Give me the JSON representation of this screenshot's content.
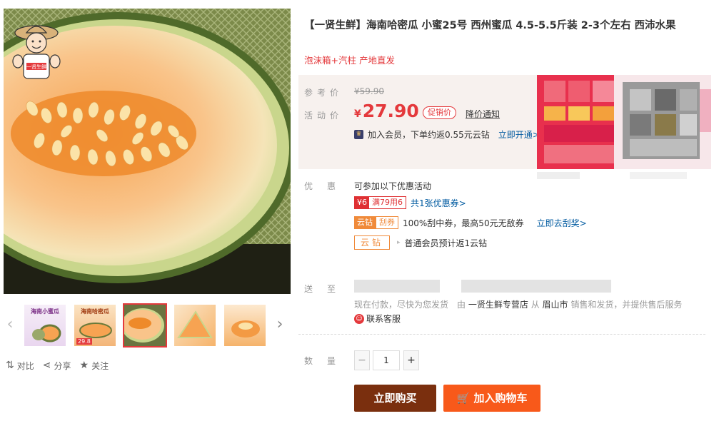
{
  "product": {
    "title": "【一贤生鲜】海南哈密瓜 小蜜25号 西州蜜瓜 4.5-5.5斤装 2-3个左右 西沛水果",
    "subtitle": "泡沫箱+汽柱 产地直发"
  },
  "price": {
    "ref_label": "参考价",
    "ref_value": "¥59.90",
    "act_label": "活动价",
    "currency": "¥",
    "act_value": "27.90",
    "promo_badge": "促销价",
    "notify_label": "降价通知",
    "member_text": "加入会员，下单约返0.55元云钻",
    "member_link": "立即开通>"
  },
  "promotions": {
    "label": "优惠",
    "intro": "可参加以下优惠活动",
    "coupon_a": "¥6",
    "coupon_b": "满79用6",
    "coupon_link": "共1张优惠券>",
    "cloud_a": "云钻",
    "cloud_b": "刮券",
    "cloud_text": "100%刮中券，最高50元无敌券",
    "cloud_link": "立即去刮奖>",
    "cloud_tag": "云钻",
    "cloud_return": "普通会员预计返1云钻"
  },
  "shipping": {
    "label": "送至",
    "note_prefix": "现在付款，尽快为您发货　由",
    "store": "一贤生鲜专营店",
    "note_mid": "从",
    "origin": "眉山市",
    "note_suffix": "销售和发货，并提供售后服务",
    "cs_label": "联系客服"
  },
  "quantity": {
    "label": "数量",
    "minus": "−",
    "value": "1",
    "plus": "+"
  },
  "buttons": {
    "buy": "立即购买",
    "cart": "加入购物车"
  },
  "gallery": {
    "mascot_text": "一贤生鲜",
    "thumb1_title": "海南小蜜瓜",
    "thumb2_title": "海南哈密瓜",
    "thumb2_tag": "29.8",
    "prev_icon": "‹",
    "next_icon": "›"
  },
  "actions": {
    "compare": "对比",
    "share": "分享",
    "follow": "关注"
  },
  "colors": {
    "accent": "#e4393c",
    "buy_button": "#7a2f0e",
    "cart_button": "#f8591a",
    "link": "#005aa0"
  }
}
